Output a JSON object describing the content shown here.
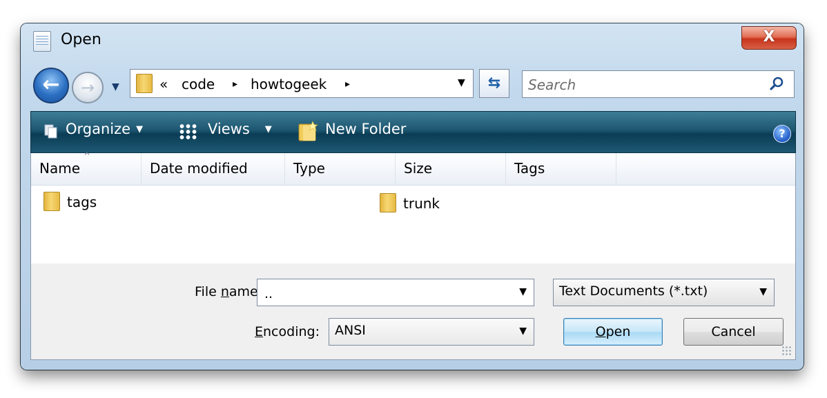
{
  "window": {
    "title": "Open",
    "close_glyph": "X"
  },
  "nav": {
    "back_glyph": "←",
    "forward_glyph": "→",
    "history_glyph": "▼"
  },
  "address": {
    "overflow_glyph": "«",
    "crumbs": [
      "code",
      "howtogeek"
    ],
    "separator_glyph": "▸",
    "dropdown_glyph": "▼"
  },
  "refresh_glyph": "⇆",
  "search": {
    "placeholder": "Search"
  },
  "toolbar": {
    "organize": "Organize",
    "views": "Views",
    "new_folder": "New Folder",
    "menu_arrow": "▼",
    "help_glyph": "?"
  },
  "columns": [
    "Name",
    "Date modified",
    "Type",
    "Size",
    "Tags"
  ],
  "sort_glyph": "^",
  "files": [
    {
      "name": "tags"
    },
    {
      "name": "trunk"
    }
  ],
  "form": {
    "file_name_label_pre": "File ",
    "file_name_label_key": "n",
    "file_name_label_post": "ame:",
    "file_name_value": "..",
    "file_type_value": "Text Documents (*.txt)",
    "encoding_label_key": "E",
    "encoding_label_post": "ncoding:",
    "encoding_value": "ANSI",
    "dropdown_glyph": "▼",
    "open_key": "O",
    "open_post": "pen",
    "cancel": "Cancel"
  },
  "icons": {
    "title": "notepad-icon",
    "folder": "folder-icon",
    "search": "search-icon",
    "organize": "organize-icon",
    "views": "views-icon",
    "new_folder": "new-folder-icon",
    "help": "help-icon"
  }
}
